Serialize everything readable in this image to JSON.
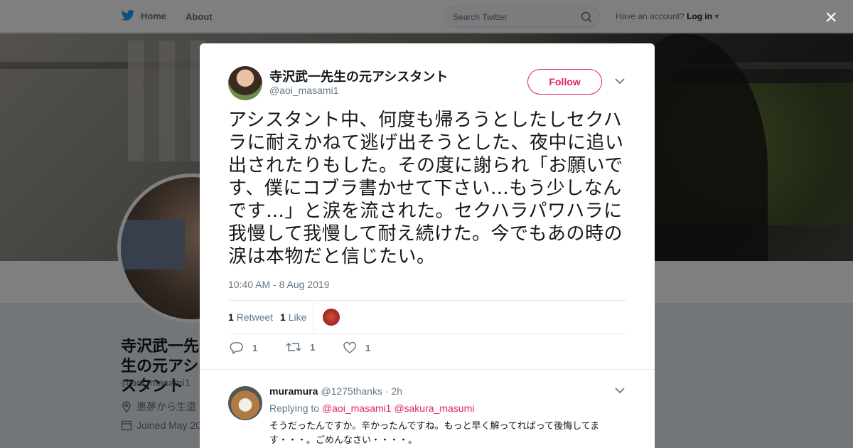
{
  "nav": {
    "home_label": "Home",
    "about_label": "About",
    "search_placeholder": "Search Twitter",
    "account_prompt": "Have an account?",
    "login_label": "Log in",
    "brand_color": "#1da1f2"
  },
  "profile": {
    "name": "寺沢武一先生の元アシスタント",
    "handle": "@aoi_masami1",
    "location": "悪夢から生還",
    "joined": "Joined May 20"
  },
  "modal": {
    "close_label": "×",
    "author_name": "寺沢武一先生の元アシスタント",
    "author_handle": "@aoi_masami1",
    "follow_label": "Follow",
    "tweet_text": "アシスタント中、何度も帰ろうとしたしセクハラに耐えかねて逃げ出そうとした、夜中に追い出されたりもした。その度に謝られ「お願いです、僕にコブラ書かせて下さい…もう少しなんです…」と涙を流された。セクハラパワハラに我慢して我慢して耐え続けた。今でもあの時の涙は本物だと信じたい。",
    "timestamp": "10:40 AM - 8 Aug 2019",
    "stats": {
      "retweets_count": "1",
      "retweets_label": "Retweet",
      "likes_count": "1",
      "likes_label": "Like"
    },
    "actions": {
      "reply_count": "1",
      "retweet_count": "1",
      "like_count": "1"
    },
    "reply": {
      "name": "muramura",
      "handle": "@1275thanks",
      "time": "· 2h",
      "replying_prefix": "Replying to",
      "replying_1": "@aoi_masami1",
      "replying_2": "@sakura_masumi",
      "text": "そうだったんですか。辛かったんですね。もっと早く解ってればって後悔してます・・・。ごめんなさい・・・・。"
    },
    "accent_color": "#e0245e"
  }
}
